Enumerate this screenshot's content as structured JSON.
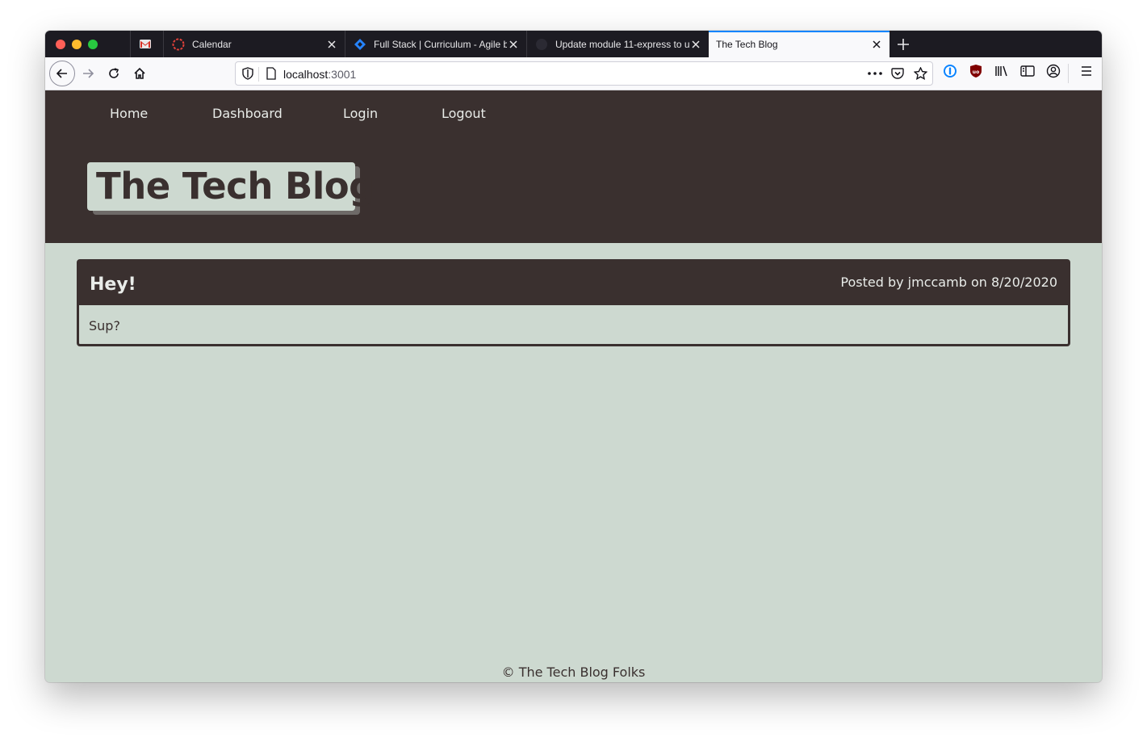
{
  "browser": {
    "tabs": [
      {
        "label": "",
        "icon": "gmail-icon"
      },
      {
        "label": "Calendar",
        "icon": "calendar-icon"
      },
      {
        "label": "Full Stack | Curriculum - Agile b",
        "icon": "jira-icon"
      },
      {
        "label": "Update module 11-express to u",
        "icon": "github-icon"
      },
      {
        "label": "The Tech Blog",
        "icon": "",
        "active": true
      }
    ],
    "url": {
      "host": "localhost",
      "port": ":3001"
    },
    "accent_color": "#0a84ff"
  },
  "site": {
    "nav": [
      "Home",
      "Dashboard",
      "Login",
      "Logout"
    ],
    "title": "The Tech Blog",
    "colors": {
      "dark": "#3a302f",
      "light": "#cdd9d0"
    }
  },
  "post": {
    "title": "Hey!",
    "meta": "Posted by jmccamb on 8/20/2020",
    "body": "Sup?"
  },
  "footer": {
    "text": "© The Tech Blog Folks"
  }
}
